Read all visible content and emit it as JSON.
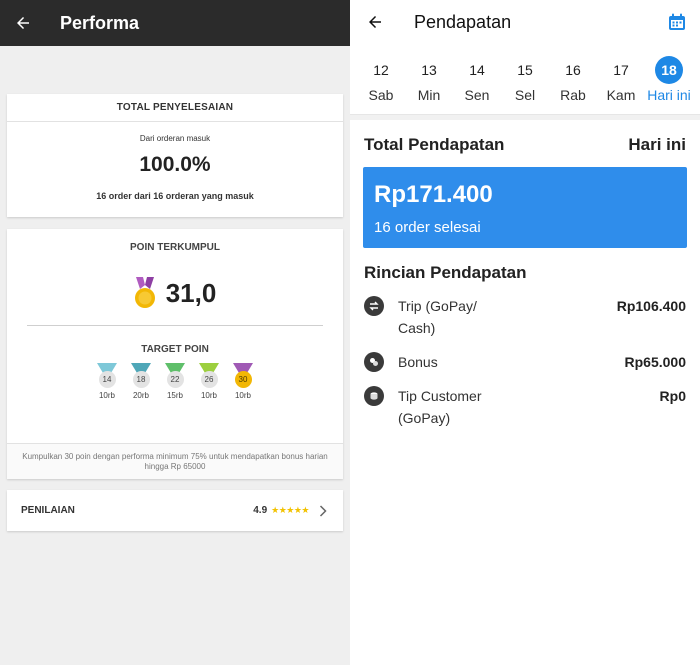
{
  "left": {
    "header": {
      "title": "Performa"
    },
    "total": {
      "heading": "TOTAL PENYELESAIAN",
      "subtitle": "Dari orderan masuk",
      "percent": "100.0%",
      "count_text": "16 order dari 16 orderan yang masuk"
    },
    "poin": {
      "heading": "POIN TERKUMPUL",
      "value": "31,0",
      "target_heading": "TARGET POIN",
      "medals": [
        {
          "points": "14",
          "amount": "10rb",
          "color": "#7ec8d8"
        },
        {
          "points": "18",
          "amount": "20rb",
          "color": "#4fa7b8"
        },
        {
          "points": "22",
          "amount": "15rb",
          "color": "#5fbf6a"
        },
        {
          "points": "26",
          "amount": "10rb",
          "color": "#9ccf3e"
        },
        {
          "points": "30",
          "amount": "10rb",
          "color": "#a05ab5"
        }
      ],
      "footer": "Kumpulkan 30 poin dengan performa minimum 75% untuk mendapatkan bonus harian hingga Rp 65000"
    },
    "penilaian": {
      "label": "PENILAIAN",
      "value": "4.9",
      "stars": "★★★★★"
    }
  },
  "right": {
    "header": {
      "title": "Pendapatan"
    },
    "dates": [
      {
        "num": "12",
        "day": "Sab"
      },
      {
        "num": "13",
        "day": "Min"
      },
      {
        "num": "14",
        "day": "Sen"
      },
      {
        "num": "15",
        "day": "Sel"
      },
      {
        "num": "16",
        "day": "Rab"
      },
      {
        "num": "17",
        "day": "Kam"
      },
      {
        "num": "18",
        "day": "Hari ini"
      }
    ],
    "total_label": "Total Pendapatan",
    "total_period": "Hari ini",
    "amount": "Rp171.400",
    "orders": "16 order selesai",
    "rincian_title": "Rincian Pendapatan",
    "items": [
      {
        "label": "Trip (GoPay/ Cash)",
        "amount": "Rp106.400"
      },
      {
        "label": "Bonus",
        "amount": "Rp65.000"
      },
      {
        "label": "Tip Customer (GoPay)",
        "amount": "Rp0"
      }
    ],
    "accent_color": "#1e88e5"
  }
}
